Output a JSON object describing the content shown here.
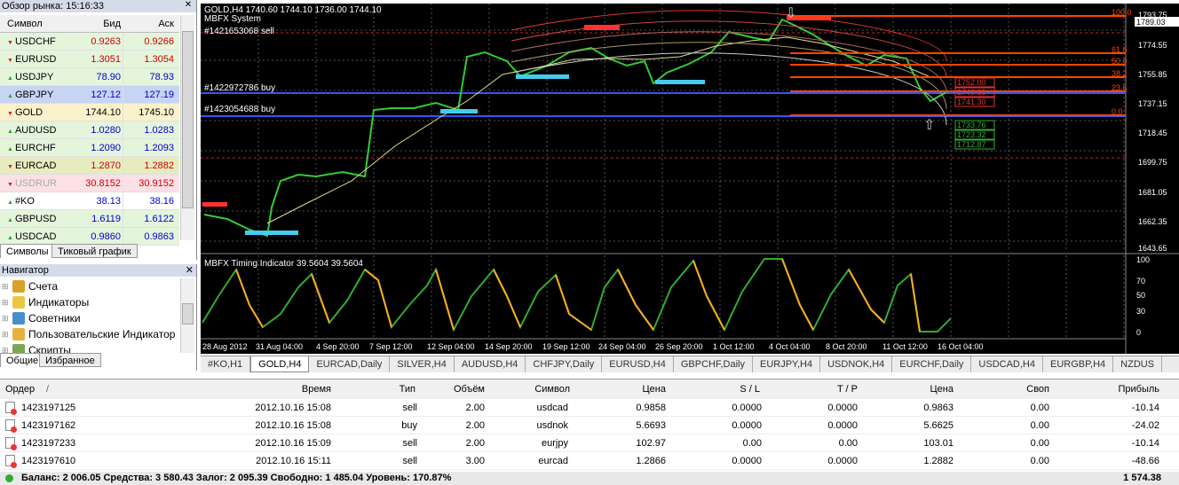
{
  "market_watch": {
    "title": "Обзор рынка: 15:16:33",
    "columns": {
      "symbol": "Символ",
      "bid": "Бид",
      "ask": "Аск"
    },
    "rows": [
      {
        "symbol": "USDCHF",
        "bid": "0.9263",
        "ask": "0.9266",
        "bg": "#e4f5dc",
        "color": "#d00000",
        "arrow": "down"
      },
      {
        "symbol": "EURUSD",
        "bid": "1.3051",
        "ask": "1.3054",
        "bg": "#e4f5dc",
        "color": "#d00000",
        "arrow": "down"
      },
      {
        "symbol": "USDJPY",
        "bid": "78.90",
        "ask": "78.93",
        "bg": "#e4f5dc",
        "color": "#0000cc",
        "arrow": "up"
      },
      {
        "symbol": "GBPJPY",
        "bid": "127.12",
        "ask": "127.19",
        "bg": "#c7d4f4",
        "color": "#0000cc",
        "arrow": "up"
      },
      {
        "symbol": "GOLD",
        "bid": "1744.10",
        "ask": "1745.10",
        "bg": "#fbf2cc",
        "color": "#000000",
        "arrow": "down"
      },
      {
        "symbol": "AUDUSD",
        "bid": "1.0280",
        "ask": "1.0283",
        "bg": "#e4f5dc",
        "color": "#0000cc",
        "arrow": "up"
      },
      {
        "symbol": "EURCHF",
        "bid": "1.2090",
        "ask": "1.2093",
        "bg": "#e4f5dc",
        "color": "#0000cc",
        "arrow": "up"
      },
      {
        "symbol": "EURCAD",
        "bid": "1.2870",
        "ask": "1.2882",
        "bg": "#e7ecc0",
        "color": "#d00000",
        "arrow": "down"
      },
      {
        "symbol": "USDRUR",
        "bid": "30.8152",
        "ask": "30.9152",
        "bg": "#fbe0e6",
        "color": "#d00000",
        "arrow": "down",
        "dim": true
      },
      {
        "symbol": "#KO",
        "bid": "38.13",
        "ask": "38.16",
        "bg": "#ffffff",
        "color": "#0000cc",
        "arrow": "up"
      },
      {
        "symbol": "GBPUSD",
        "bid": "1.6119",
        "ask": "1.6122",
        "bg": "#e4f5dc",
        "color": "#0000cc",
        "arrow": "up"
      },
      {
        "symbol": "USDCAD",
        "bid": "0.9860",
        "ask": "0.9863",
        "bg": "#e4f5dc",
        "color": "#0000cc",
        "arrow": "up"
      }
    ],
    "tabs": [
      "Символы",
      "Тиковый график"
    ]
  },
  "navigator": {
    "title": "Навигатор",
    "items": [
      {
        "label": "Счета",
        "icon": "accounts-icon"
      },
      {
        "label": "Индикаторы",
        "icon": "indicators-icon"
      },
      {
        "label": "Советники",
        "icon": "experts-icon"
      },
      {
        "label": "Пользовательские Индикатор",
        "icon": "custom-indicators-icon"
      },
      {
        "label": "Скрипты",
        "icon": "scripts-icon"
      }
    ],
    "tabs": [
      "Общие",
      "Избранное"
    ]
  },
  "chart": {
    "header": "GOLD,H4  1740.60 1744.10 1736.00 1744.10",
    "system": "MBFX System",
    "order_labels": [
      "#1421653068 sell",
      "#1422972786 buy",
      "#1423054688 buy"
    ],
    "price_axis": [
      "1793.75",
      "1774.55",
      "1755.85",
      "1737.15",
      "1718.45",
      "1699.75",
      "1681.05",
      "1662.35",
      "1643.65"
    ],
    "current_price": "1789.03",
    "fib_levels": [
      "100.0",
      "61.8",
      "50.0",
      "38.2",
      "23.6",
      "0.0"
    ],
    "boxes_red": [
      "1752.00",
      "1749.60",
      "1741.30"
    ],
    "boxes_green": [
      "1733.76",
      "1723.32",
      "1712.87"
    ],
    "indicator_title": "MBFX Timing Indicator 39.5604 39.5604",
    "indicator_axis": [
      "100",
      "70",
      "50",
      "30",
      "0"
    ],
    "time_axis": [
      "28 Aug 2012",
      "31 Aug 04:00",
      "4 Sep 20:00",
      "7 Sep 12:00",
      "12 Sep 04:00",
      "14 Sep 20:00",
      "19 Sep 12:00",
      "24 Sep 04:00",
      "26 Sep 20:00",
      "1 Oct 12:00",
      "4 Oct 04:00",
      "8 Oct 20:00",
      "11 Oct 12:00",
      "16 Oct 04:00"
    ],
    "tabs": [
      "#KO,H1",
      "GOLD,H4",
      "EURCAD,Daily",
      "SILVER,H4",
      "AUDUSD,H4",
      "CHFJPY,Daily",
      "EURUSD,H4",
      "GBPCHF,Daily",
      "EURJPY,H4",
      "USDNOK,H4",
      "EURCHF,Daily",
      "USDCAD,H4",
      "EURGBP,H4",
      "NZDUS"
    ]
  },
  "terminal": {
    "columns": [
      "Ордер",
      "/",
      "Время",
      "Тип",
      "Объём",
      "Символ",
      "Цена",
      "S / L",
      "T / P",
      "Цена",
      "Своп",
      "Прибыль"
    ],
    "orders": [
      {
        "id": "1423197125",
        "time": "2012.10.16 15:08",
        "type": "sell",
        "volume": "2.00",
        "symbol": "usdcad",
        "price": "0.9858",
        "sl": "0.0000",
        "tp": "0.0000",
        "cur": "0.9863",
        "swap": "0.00",
        "profit": "-10.14"
      },
      {
        "id": "1423197162",
        "time": "2012.10.16 15:08",
        "type": "buy",
        "volume": "2.00",
        "symbol": "usdnok",
        "price": "5.6693",
        "sl": "0.0000",
        "tp": "0.0000",
        "cur": "5.6625",
        "swap": "0.00",
        "profit": "-24.02"
      },
      {
        "id": "1423197233",
        "time": "2012.10.16 15:09",
        "type": "sell",
        "volume": "2.00",
        "symbol": "eurjpy",
        "price": "102.97",
        "sl": "0.00",
        "tp": "0.00",
        "cur": "103.01",
        "swap": "0.00",
        "profit": "-10.14"
      },
      {
        "id": "1423197610",
        "time": "2012.10.16 15:11",
        "type": "sell",
        "volume": "3.00",
        "symbol": "eurcad",
        "price": "1.2866",
        "sl": "0.0000",
        "tp": "0.0000",
        "cur": "1.2882",
        "swap": "0.00",
        "profit": "-48.66"
      }
    ],
    "balance": "Баланс: 2 006.05  Средства: 3 580.43  Залог: 2 095.39  Свободно: 1 485.04  Уровень: 170.87%",
    "total": "1 574.38"
  }
}
